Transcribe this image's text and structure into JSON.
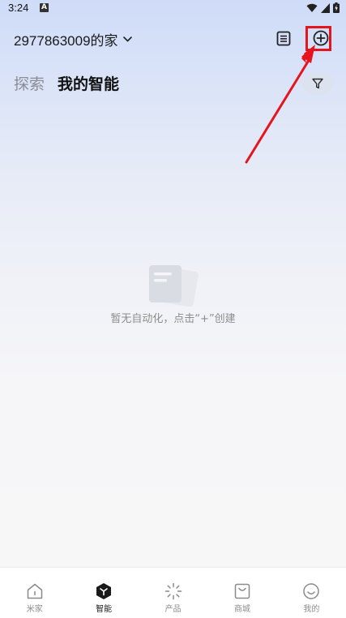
{
  "status_bar": {
    "time": "3:24",
    "notification_letter": "A"
  },
  "header": {
    "home_name": "2977863009的家"
  },
  "tabs": {
    "explore": "探索",
    "mine": "我的智能"
  },
  "empty_state": {
    "message": "暂无自动化，点击“+”创建"
  },
  "bottom_nav": {
    "items": [
      {
        "label": "米家",
        "icon": "home-icon"
      },
      {
        "label": "智能",
        "icon": "smart-cube-icon",
        "active": true
      },
      {
        "label": "产品",
        "icon": "product-sparkle-icon"
      },
      {
        "label": "商城",
        "icon": "shopping-bag-icon"
      },
      {
        "label": "我的",
        "icon": "smiley-icon"
      }
    ]
  },
  "colors": {
    "annotation_red": "#e5141d",
    "active_text": "#1a1a1a",
    "inactive_text": "#8c8c8c"
  }
}
